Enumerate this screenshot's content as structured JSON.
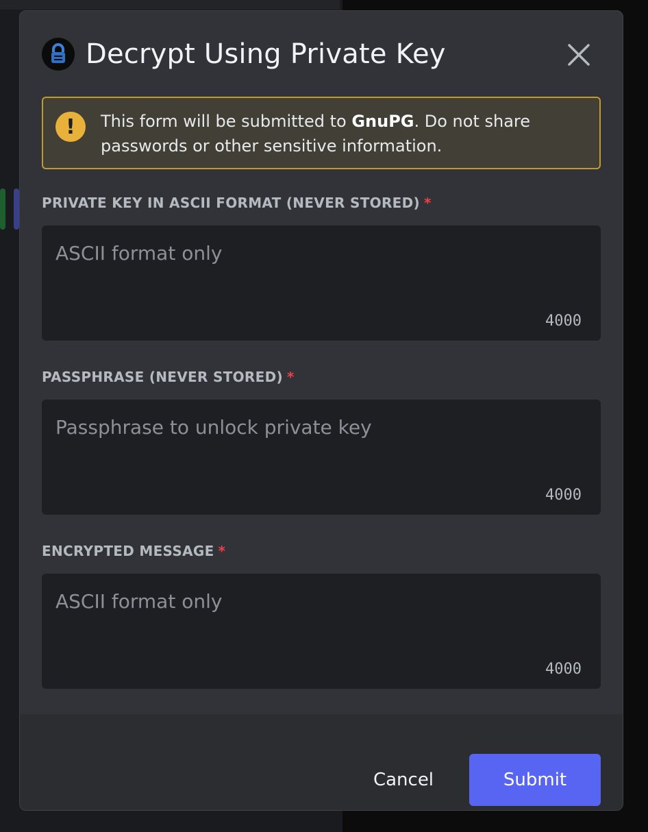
{
  "modal": {
    "title": "Decrypt Using Private Key",
    "app_icon": "gnupg-lock-icon",
    "close_icon": "close-icon"
  },
  "notice": {
    "icon": "warning-icon",
    "text_before": "This form will be submitted to ",
    "app_name": "GnuPG",
    "text_after": ". Do not share passwords or other sensitive information."
  },
  "fields": [
    {
      "label": "PRIVATE KEY IN ASCII FORMAT (NEVER STORED)",
      "required_mark": "*",
      "placeholder": "ASCII format only",
      "value": "",
      "counter": "4000"
    },
    {
      "label": "PASSPHRASE (NEVER STORED)",
      "required_mark": "*",
      "placeholder": "Passphrase to unlock private key",
      "value": "",
      "counter": "4000"
    },
    {
      "label": "ENCRYPTED MESSAGE",
      "required_mark": "*",
      "placeholder": "ASCII format only",
      "value": "",
      "counter": "4000"
    }
  ],
  "footer": {
    "cancel_label": "Cancel",
    "submit_label": "Submit"
  },
  "colors": {
    "accent": "#5865f2",
    "warning": "#e8b13a",
    "required": "#f23f43"
  }
}
